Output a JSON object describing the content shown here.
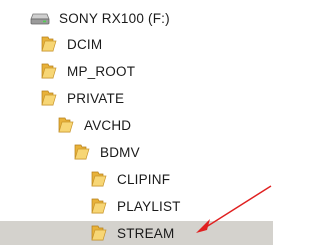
{
  "drive": {
    "label": "SONY RX100 (F:)",
    "icon": "drive-icon"
  },
  "folders": [
    {
      "label": "DCIM",
      "icon": "folder-icon",
      "depth": 1
    },
    {
      "label": "MP_ROOT",
      "icon": "folder-icon",
      "depth": 1
    },
    {
      "label": "PRIVATE",
      "icon": "folder-icon",
      "depth": 1
    },
    {
      "label": "AVCHD",
      "icon": "folder-icon",
      "depth": 2
    },
    {
      "label": "BDMV",
      "icon": "folder-icon",
      "depth": 3
    },
    {
      "label": "CLIPINF",
      "icon": "folder-icon",
      "depth": 4
    },
    {
      "label": "PLAYLIST",
      "icon": "folder-icon",
      "depth": 4
    },
    {
      "label": "STREAM",
      "icon": "folder-icon",
      "depth": 4,
      "selected": true
    }
  ],
  "colors": {
    "selection": "#d4d2cd",
    "folder_back": "#e8b23a",
    "folder_front": "#f7d675",
    "annotation_arrow": "#e02020"
  }
}
